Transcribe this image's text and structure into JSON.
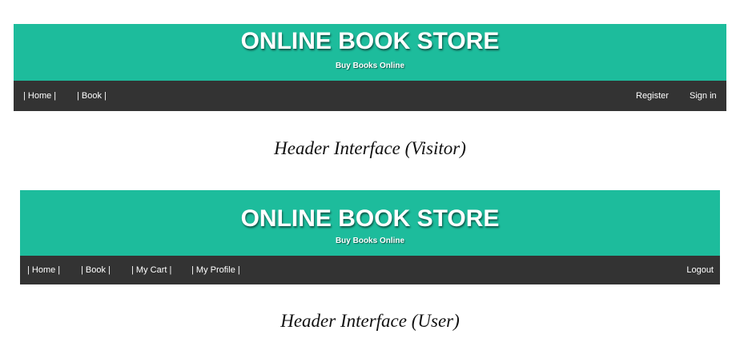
{
  "visitor_header": {
    "title": "ONLINE BOOK STORE",
    "subtitle": "Buy Books Online",
    "nav_left": [
      "| Home |",
      "| Book |"
    ],
    "nav_right": [
      "Register",
      "Sign in"
    ]
  },
  "visitor_caption": "Header Interface (Visitor)",
  "user_header": {
    "title": "ONLINE BOOK STORE",
    "subtitle": "Buy Books Online",
    "nav_left": [
      "| Home |",
      "| Book |",
      "| My Cart |",
      "| My Profile |"
    ],
    "nav_right": [
      "Logout"
    ]
  },
  "user_caption": "Header Interface (User)",
  "colors": {
    "banner": "#1dbc9c",
    "navbar": "#333333",
    "text_light": "#ffffff"
  }
}
